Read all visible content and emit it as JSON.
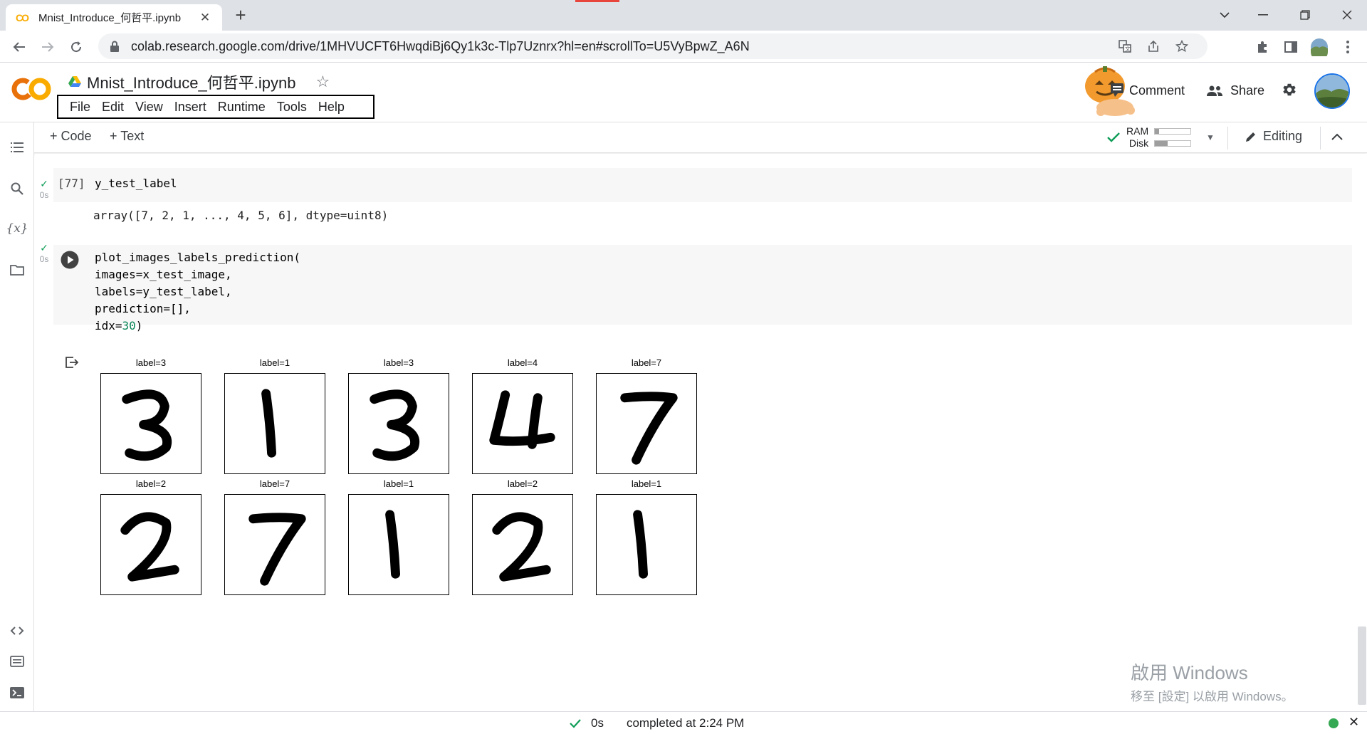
{
  "browser": {
    "tab_title": "Mnist_Introduce_何哲平.ipynb",
    "tab_close": "✕",
    "new_tab": "+",
    "url": "colab.research.google.com/drive/1MHVUCFT6HwqdiBj6Qy1k3c-Tlp7Uznrx?hl=en#scrollTo=U5VyBpwZ_A6N",
    "window_controls": [
      "chevron-down",
      "minimize",
      "restore",
      "close"
    ]
  },
  "header": {
    "logo_text": "CO",
    "notebook_title": "Mnist_Introduce_何哲平.ipynb",
    "menu": [
      "File",
      "Edit",
      "View",
      "Insert",
      "Runtime",
      "Tools",
      "Help"
    ],
    "comment_label": "Comment",
    "share_label": "Share"
  },
  "toolbar": {
    "code_label": "+ Code",
    "text_label": "+ Text",
    "ram_label": "RAM",
    "disk_label": "Disk",
    "ram_fraction": 0.12,
    "disk_fraction": 0.35,
    "editing_label": "Editing"
  },
  "cells": {
    "cell1": {
      "status_time": "0s",
      "exec_count": "[77]",
      "code": "y_test_label",
      "output": "array([7, 2, 1, ..., 4, 5, 6], dtype=uint8)"
    },
    "cell2": {
      "status_time": "0s",
      "code_lines": [
        "plot_images_labels_prediction(",
        "images=x_test_image,",
        "labels=y_test_label,",
        "prediction=[],",
        "idx="
      ],
      "idx_value": "30",
      "idx_close": ")",
      "images": [
        {
          "label": "label=3",
          "digit": "3"
        },
        {
          "label": "label=1",
          "digit": "1"
        },
        {
          "label": "label=3",
          "digit": "3"
        },
        {
          "label": "label=4",
          "digit": "4"
        },
        {
          "label": "label=7",
          "digit": "7"
        },
        {
          "label": "label=2",
          "digit": "2"
        },
        {
          "label": "label=7",
          "digit": "7"
        },
        {
          "label": "label=1",
          "digit": "1"
        },
        {
          "label": "label=2",
          "digit": "2"
        },
        {
          "label": "label=1",
          "digit": "1"
        }
      ]
    }
  },
  "watermark": {
    "line1": "啟用 Windows",
    "line2": "移至 [設定] 以啟用 Windows。"
  },
  "status_bar": {
    "time": "0s",
    "text": "completed at 2:24 PM"
  }
}
